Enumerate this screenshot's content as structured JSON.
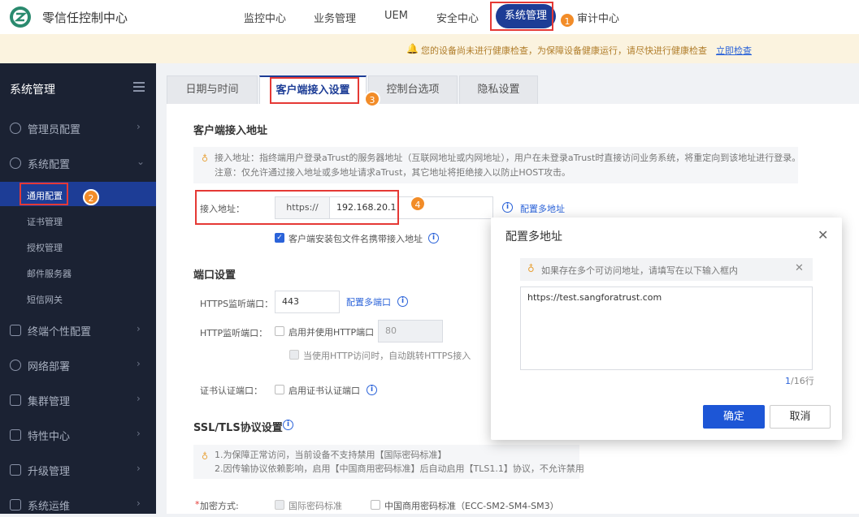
{
  "app": {
    "title": "零信任控制中心"
  },
  "nav": {
    "items": [
      "监控中心",
      "业务管理",
      "UEM",
      "安全中心"
    ],
    "active": "系统管理",
    "last": "审计中心"
  },
  "notice": {
    "text": "您的设备尚未进行健康检查，为保障设备健康运行，请尽快进行健康检查",
    "link": "立即检查"
  },
  "sidebar": {
    "title": "系统管理",
    "items": [
      {
        "label": "管理员配置",
        "icon": "user-icon"
      },
      {
        "label": "系统配置",
        "icon": "gear-icon"
      },
      {
        "label": "终端个性配置",
        "icon": "monitor-icon"
      },
      {
        "label": "网络部署",
        "icon": "globe-icon"
      },
      {
        "label": "集群管理",
        "icon": "cluster-icon"
      },
      {
        "label": "特性中心",
        "icon": "grid-icon"
      },
      {
        "label": "升级管理",
        "icon": "upload-icon"
      },
      {
        "label": "系统运维",
        "icon": "tools-icon"
      }
    ],
    "sub_items": [
      "通用配置",
      "证书管理",
      "授权管理",
      "邮件服务器",
      "短信网关"
    ]
  },
  "tabs": [
    "日期与时间",
    "客户端接入设置",
    "控制台选项",
    "隐私设置"
  ],
  "access": {
    "section_title": "客户端接入地址",
    "tip_line1": "接入地址：指终端用户登录aTrust的服务器地址（互联网地址或内网地址），用户在未登录aTrust时直接访问业务系统，将重定向到该地址进行登录。",
    "tip_line2": "注意：仅允许通过接入地址或多地址请求aTrust，其它地址将拒绝接入以防止HOST攻击。",
    "label": "接入地址：",
    "protocol": "https://",
    "value": "192.168.20.1",
    "multi_link": "配置多地址",
    "checkbox_label": "客户端安装包文件名携带接入地址"
  },
  "ports": {
    "section_title": "端口设置",
    "https_label": "HTTPS监听端口：",
    "https_value": "443",
    "https_link": "配置多端口",
    "http_label": "HTTP监听端口：",
    "http_checkbox": "启用并使用HTTP端口",
    "http_value": "80",
    "http_redirect": "当使用HTTP访问时，自动跳转HTTPS接入",
    "cert_label": "证书认证端口：",
    "cert_checkbox": "启用证书认证端口"
  },
  "ssl": {
    "section_title": "SSL/TLS协议设置",
    "tip_line1": "1.为保障正常访问，当前设备不支持禁用【国际密码标准】",
    "tip_line2": "2.因传输协议依赖影响，启用【中国商用密码标准】后自动启用【TLS1.1】协议，不允许禁用",
    "cipher_label": "加密方式:",
    "required_mark": "*",
    "opt1": "国际密码标准",
    "opt2": "中国商用密码标准（ECC-SM2-SM4-SM3）"
  },
  "modal": {
    "title": "配置多地址",
    "tip": "如果存在多个可访问地址，请填写在以下输入框内",
    "textarea_value": "https://test.sangforatrust.com",
    "counter_current": "1",
    "counter_total": "/16行",
    "ok": "确定",
    "cancel": "取消"
  },
  "annotations": [
    "1",
    "2",
    "3",
    "4"
  ],
  "colors": {
    "primary": "#1d3d96",
    "accent": "#1d56d6",
    "sidebar": "#1b2233",
    "annotation": "#e53935",
    "badge": "#f28c28"
  }
}
